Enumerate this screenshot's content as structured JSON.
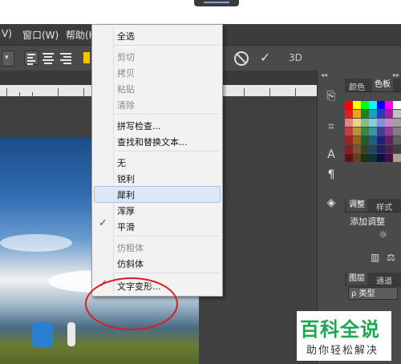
{
  "menubar": {
    "items": [
      "V)",
      "窗口(W)",
      "帮助(H"
    ]
  },
  "options_bar": {
    "zero": "0",
    "threed": "3D"
  },
  "context_menu": {
    "items": [
      {
        "label": "全选",
        "enabled": true,
        "checked": false
      },
      {
        "label": "剪切",
        "enabled": false,
        "checked": false
      },
      {
        "label": "拷贝",
        "enabled": false,
        "checked": false
      },
      {
        "label": "粘贴",
        "enabled": false,
        "checked": false
      },
      {
        "label": "清除",
        "enabled": false,
        "checked": false
      },
      {
        "label": "拼写检查...",
        "enabled": true,
        "checked": false
      },
      {
        "label": "查找和替换文本...",
        "enabled": true,
        "checked": false
      },
      {
        "label": "无",
        "enabled": true,
        "checked": false
      },
      {
        "label": "锐利",
        "enabled": true,
        "checked": false
      },
      {
        "label": "犀利",
        "enabled": true,
        "checked": false,
        "highlighted": true
      },
      {
        "label": "浑厚",
        "enabled": true,
        "checked": false
      },
      {
        "label": "平滑",
        "enabled": true,
        "checked": true
      },
      {
        "label": "仿粗体",
        "enabled": false,
        "checked": false
      },
      {
        "label": "仿斜体",
        "enabled": true,
        "checked": false
      },
      {
        "label": "文字变形...",
        "enabled": true,
        "checked": true
      }
    ],
    "check_glyph": "✓"
  },
  "panels": {
    "color_tabs": [
      "颜色",
      "色板"
    ],
    "adjust_tabs": [
      "调整",
      "样式"
    ],
    "adjust_title": "添加调整",
    "layer_tabs": [
      "图层",
      "通道"
    ],
    "layer_filter": "ρ 类型"
  },
  "watermark": {
    "top": "百科全说",
    "bottom": "助你轻松解决"
  },
  "colors": {
    "menu_bg": "#f2f2f2",
    "highlight": "#dde8f7",
    "annotation": "#d81e1e",
    "watermark_green": "#1aa84f"
  }
}
